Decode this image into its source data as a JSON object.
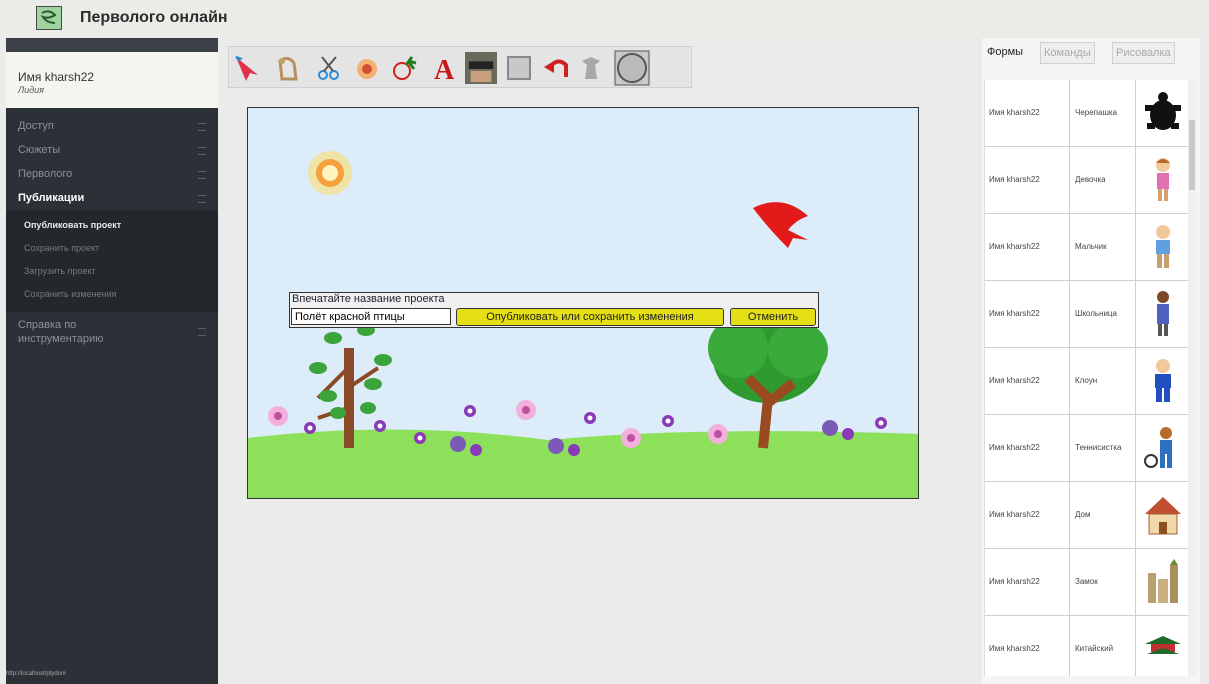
{
  "app": {
    "title": "Перволого онлайн"
  },
  "user": {
    "name": "Имя kharsh22",
    "role": "Лидия"
  },
  "sidebar": {
    "items": [
      {
        "label": "Доступ"
      },
      {
        "label": "Сюжеты"
      },
      {
        "label": "Перволого"
      },
      {
        "label": "Публикации"
      }
    ],
    "submenu": [
      {
        "label": "Опубликовать проект"
      },
      {
        "label": "Сохранить проект"
      },
      {
        "label": "Загрузить проект"
      },
      {
        "label": "Сохранить изменения"
      }
    ],
    "help": {
      "line1": "Справка по",
      "line2": "инструментарию"
    }
  },
  "status_url": "http://localhost/ptydo/#",
  "toolbar": {
    "tools": [
      "select-arrow-icon",
      "turtle-hand-icon",
      "scissors-icon",
      "paint-icon",
      "fruit-icon",
      "text-icon",
      "camera-icon",
      "rectangle-icon",
      "undo-icon",
      "stamp-icon",
      "circle-icon"
    ]
  },
  "dialog": {
    "prompt": "Впечатайте название проекта",
    "input_value": "Полёт красной птицы",
    "publish_label": "Опубликовать или сохранить изменения",
    "cancel_label": "Отменить"
  },
  "panel": {
    "tabs": [
      {
        "label": "Формы"
      },
      {
        "label": "Команды"
      },
      {
        "label": "Рисовалка"
      }
    ],
    "shapes": [
      {
        "owner": "Имя kharsh22",
        "name": "Черепашка",
        "icon": "turtle-icon"
      },
      {
        "owner": "Имя kharsh22",
        "name": "Девочка",
        "icon": "girl-icon"
      },
      {
        "owner": "Имя kharsh22",
        "name": "Мальчик",
        "icon": "boy-icon"
      },
      {
        "owner": "Имя kharsh22",
        "name": "Школьница",
        "icon": "schoolgirl-icon"
      },
      {
        "owner": "Имя kharsh22",
        "name": "Клоун",
        "icon": "clown-icon"
      },
      {
        "owner": "Имя kharsh22",
        "name": "Теннисистка",
        "icon": "tennis-player-icon"
      },
      {
        "owner": "Имя kharsh22",
        "name": "Дом",
        "icon": "house-icon"
      },
      {
        "owner": "Имя kharsh22",
        "name": "Замок",
        "icon": "castle-icon"
      },
      {
        "owner": "Имя kharsh22",
        "name": "Китайский",
        "icon": "pagoda-icon"
      }
    ]
  },
  "colors": {
    "sidebar": "#2c3137",
    "button": "#e5df16",
    "sky": "#dcecf8",
    "grass": "#8de05a"
  }
}
